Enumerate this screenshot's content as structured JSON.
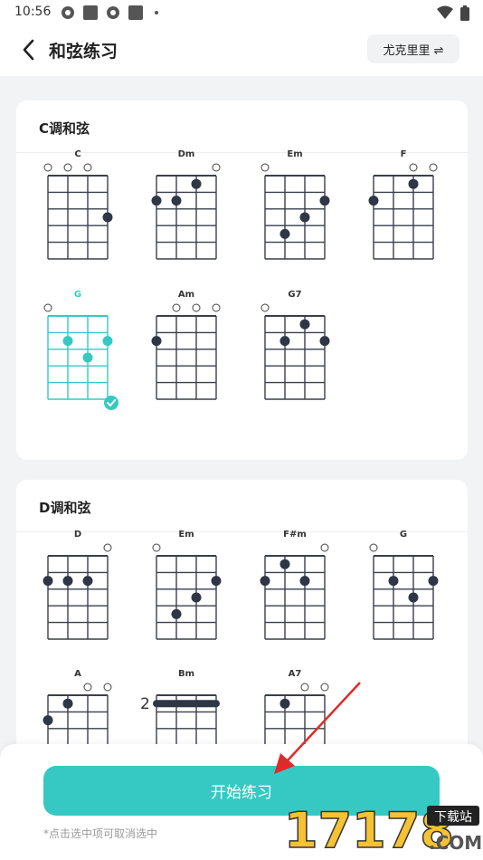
{
  "status_bar": {
    "time": "10:56"
  },
  "header": {
    "title": "和弦练习",
    "instrument_button": "尤克里里 ⇌"
  },
  "sections": [
    {
      "title": "C调和弦",
      "chords": [
        {
          "name": "C",
          "open": [
            true,
            true,
            true,
            false
          ],
          "dots": [
            {
              "s": 3,
              "f": 3
            }
          ],
          "barre": null,
          "selected": false
        },
        {
          "name": "Dm",
          "open": [
            false,
            false,
            false,
            true
          ],
          "dots": [
            {
              "s": 0,
              "f": 2
            },
            {
              "s": 1,
              "f": 2
            },
            {
              "s": 2,
              "f": 1
            }
          ],
          "barre": null,
          "selected": false
        },
        {
          "name": "Em",
          "open": [
            true,
            false,
            false,
            false
          ],
          "dots": [
            {
              "s": 3,
              "f": 2
            },
            {
              "s": 2,
              "f": 3
            },
            {
              "s": 1,
              "f": 4
            }
          ],
          "barre": null,
          "selected": false
        },
        {
          "name": "F",
          "open": [
            false,
            false,
            true,
            true
          ],
          "dots": [
            {
              "s": 0,
              "f": 2
            },
            {
              "s": 2,
              "f": 1
            }
          ],
          "barre": null,
          "selected": false
        },
        {
          "name": "G",
          "open": [
            true,
            false,
            false,
            false
          ],
          "dots": [
            {
              "s": 1,
              "f": 2
            },
            {
              "s": 3,
              "f": 2
            },
            {
              "s": 2,
              "f": 3
            }
          ],
          "barre": null,
          "selected": true
        },
        {
          "name": "Am",
          "open": [
            false,
            true,
            true,
            true
          ],
          "dots": [
            {
              "s": 0,
              "f": 2
            }
          ],
          "barre": null,
          "selected": false
        },
        {
          "name": "G7",
          "open": [
            true,
            false,
            false,
            false
          ],
          "dots": [
            {
              "s": 2,
              "f": 1
            },
            {
              "s": 1,
              "f": 2
            },
            {
              "s": 3,
              "f": 2
            }
          ],
          "barre": null,
          "selected": false
        }
      ]
    },
    {
      "title": "D调和弦",
      "chords": [
        {
          "name": "D",
          "open": [
            false,
            false,
            false,
            true
          ],
          "dots": [
            {
              "s": 0,
              "f": 2
            },
            {
              "s": 1,
              "f": 2
            },
            {
              "s": 2,
              "f": 2
            }
          ],
          "barre": null,
          "selected": false
        },
        {
          "name": "Em",
          "open": [
            true,
            false,
            false,
            false
          ],
          "dots": [
            {
              "s": 3,
              "f": 2
            },
            {
              "s": 2,
              "f": 3
            },
            {
              "s": 1,
              "f": 4
            }
          ],
          "barre": null,
          "selected": false
        },
        {
          "name": "F#m",
          "open": [
            false,
            false,
            false,
            true
          ],
          "dots": [
            {
              "s": 1,
              "f": 1
            },
            {
              "s": 0,
              "f": 2
            },
            {
              "s": 2,
              "f": 2
            }
          ],
          "barre": null,
          "selected": false
        },
        {
          "name": "G",
          "open": [
            true,
            false,
            false,
            false
          ],
          "dots": [
            {
              "s": 1,
              "f": 2
            },
            {
              "s": 3,
              "f": 2
            },
            {
              "s": 2,
              "f": 3
            }
          ],
          "barre": null,
          "selected": false
        },
        {
          "name": "A",
          "open": [
            false,
            false,
            true,
            true
          ],
          "dots": [
            {
              "s": 1,
              "f": 1
            },
            {
              "s": 0,
              "f": 2
            }
          ],
          "barre": null,
          "selected": false
        },
        {
          "name": "Bm",
          "open": [
            false,
            false,
            false,
            false
          ],
          "dots": [],
          "barre": {
            "label": "2"
          },
          "selected": false
        },
        {
          "name": "A7",
          "open": [
            false,
            false,
            true,
            true
          ],
          "dots": [
            {
              "s": 1,
              "f": 1
            }
          ],
          "barre": null,
          "selected": false
        }
      ]
    }
  ],
  "bottom": {
    "start_button": "开始练习",
    "hint": "*点击选中项可取消选中"
  },
  "watermark": {
    "number": "17178",
    "badge": "下载站",
    "domain": ".COM"
  },
  "colors": {
    "accent": "#36c9c3",
    "dot": "#2f3646",
    "grid": "#3a3f4b"
  }
}
